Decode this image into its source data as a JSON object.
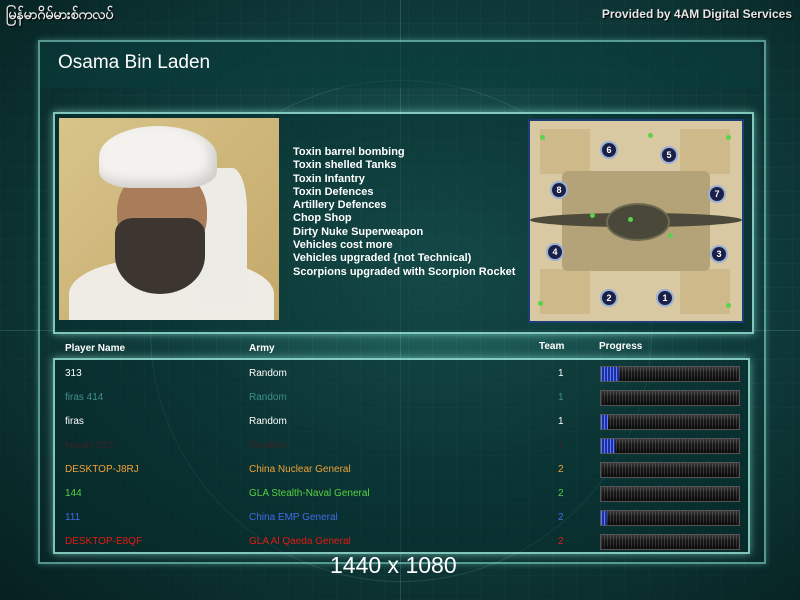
{
  "top_bar": {
    "left_title": "မြန်မာဂိမ်မားစ်ကလပ်",
    "provider": "Provided by 4AM Digital Services"
  },
  "general": {
    "name": "Osama Bin Laden",
    "features": [
      "Toxin barrel bombing",
      "Toxin shelled Tanks",
      "Toxin Infantry",
      "Toxin Defences",
      "Artillery Defences",
      "Chop Shop",
      "Dirty Nuke Superweapon",
      "Vehicles cost more",
      "Vehicles upgraded {not Technical)",
      "Scorpions upgraded with Scorpion Rocket"
    ]
  },
  "map": {
    "start_positions": [
      "1",
      "2",
      "3",
      "4",
      "5",
      "6",
      "7",
      "8"
    ]
  },
  "table": {
    "headers": {
      "player": "Player Name",
      "army": "Army",
      "team": "Team",
      "progress": "Progress"
    },
    "rows": [
      {
        "name": "313",
        "army": "Random",
        "team": "1",
        "progress": 0.13,
        "color": "#ffffff"
      },
      {
        "name": "firas 414",
        "army": "Random",
        "team": "1",
        "progress": 0.0,
        "color": "#3f8f8c"
      },
      {
        "name": "firas",
        "army": "Random",
        "team": "1",
        "progress": 0.05,
        "color": "#ffffff"
      },
      {
        "name": "hussin 515",
        "army": "Random",
        "team": "1",
        "progress": 0.1,
        "color": "#3a2428"
      },
      {
        "name": "DESKTOP-J8RJ",
        "army": "China Nuclear General",
        "team": "2",
        "progress": 0.0,
        "color": "#f0a23a"
      },
      {
        "name": "144",
        "army": "GLA Stealth-Naval General",
        "team": "2",
        "progress": 0.0,
        "color": "#58d040"
      },
      {
        "name": "111",
        "army": "China EMP General",
        "team": "2",
        "progress": 0.04,
        "color": "#3f6ce8"
      },
      {
        "name": "DESKTOP-E8QF",
        "army": "GLA Al Qaeda General",
        "team": "2",
        "progress": 0.0,
        "color": "#e21c12"
      }
    ]
  },
  "resolution": "1440 x 1080"
}
